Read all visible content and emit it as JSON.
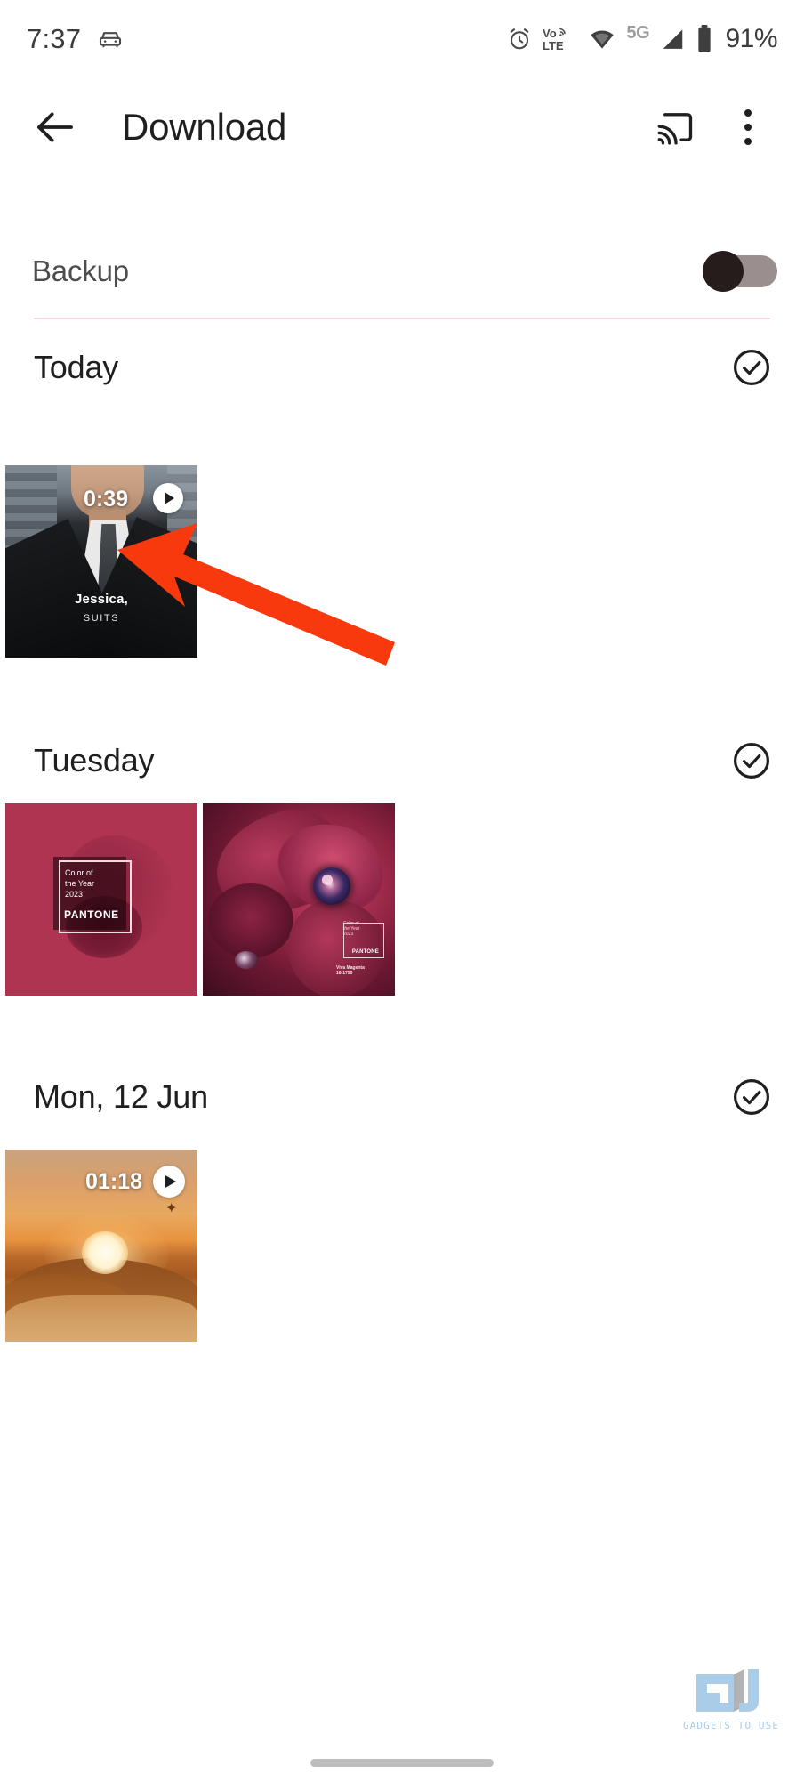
{
  "status_bar": {
    "time": "7:37",
    "left_icons": [
      "car-icon"
    ],
    "right_icons": [
      "alarm-icon",
      "volte-icon",
      "wifi-icon"
    ],
    "volte_label_top": "Vo",
    "volte_label_bottom": "LTE",
    "network": "5G",
    "battery_percent": "91%"
  },
  "app_bar": {
    "back_icon": "arrow-left-icon",
    "title": "Download",
    "cast_icon": "cast-icon",
    "overflow_icon": "more-vertical-icon"
  },
  "backup": {
    "label": "Backup",
    "toggle_state": "off"
  },
  "sections": [
    {
      "title": "Today",
      "select_icon": "check-circle-icon",
      "items": [
        {
          "type": "video",
          "duration": "0:39",
          "play_icon": "play-circle-icon",
          "caption_line1": "Jessica,",
          "caption_line2": "SUITS",
          "alt": "man in dark suit video thumbnail"
        }
      ]
    },
    {
      "title": "Tuesday",
      "select_icon": "check-circle-icon",
      "items": [
        {
          "type": "image",
          "alt": "Pantone Color of the Year 2023 flat magenta card",
          "card_line1": "Color of",
          "card_line2": "the Year",
          "card_line3": "2023",
          "card_brand": "PANTONE",
          "bg_color": "#ae3452"
        },
        {
          "type": "image",
          "alt": "Pantone Viva Magenta creature artwork",
          "card_line1": "Color of",
          "card_line2": "the Year",
          "card_line3": "2023",
          "card_brand": "PANTONE",
          "card_sub1": "Viva Magenta",
          "card_sub2": "18-1750",
          "bg_color": "#8d2447"
        }
      ]
    },
    {
      "title": "Mon, 12 Jun",
      "select_icon": "check-circle-icon",
      "items": [
        {
          "type": "video",
          "duration": "01:18",
          "play_icon": "play-circle-icon",
          "alt": "desert sunset video thumbnail"
        }
      ]
    }
  ],
  "annotation": {
    "arrow_color": "#F8380D",
    "arrow_name": "red-pointer-arrow",
    "points_to": "Today video thumbnail"
  },
  "watermark": {
    "logo": "GU",
    "text": "GADGETS TO USE",
    "color": "#a9cde8"
  },
  "nav_bar": {
    "handle": "gesture-nav-handle"
  }
}
